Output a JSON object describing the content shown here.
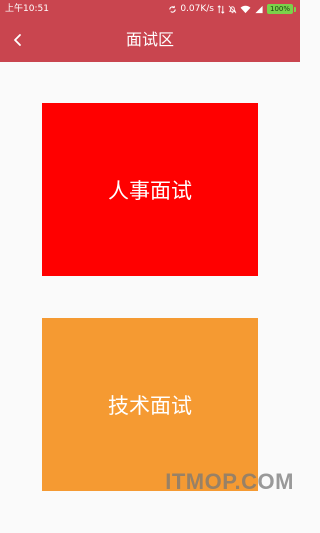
{
  "status_bar": {
    "time": "上午10:51",
    "network_speed": "0.07K/s",
    "battery_percent": "100%",
    "icons": [
      "sync-icon",
      "speed-icon",
      "alarm-icon",
      "wifi-icon",
      "signal-icon",
      "battery-icon"
    ]
  },
  "header": {
    "back_icon": "chevron-left-icon",
    "title": "面试区"
  },
  "cards": {
    "hr": {
      "label": "人事面试",
      "color": "#ff0000"
    },
    "tech": {
      "label": "技术面试",
      "color": "#f59a32"
    }
  },
  "colors": {
    "header": "#c9454f",
    "background": "#fafafa"
  },
  "watermark": "ITMOP.COM"
}
